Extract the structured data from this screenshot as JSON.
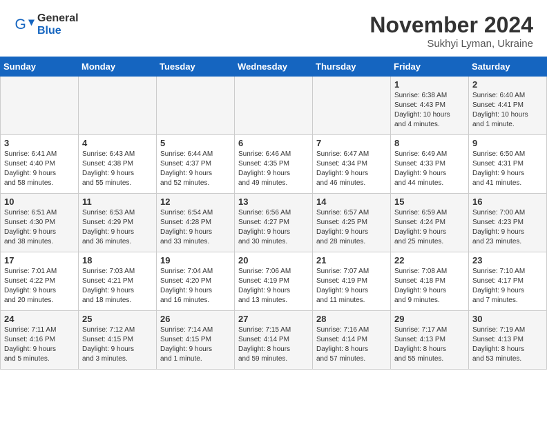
{
  "logo": {
    "general": "General",
    "blue": "Blue"
  },
  "header": {
    "month": "November 2024",
    "location": "Sukhyi Lyman, Ukraine"
  },
  "days_of_week": [
    "Sunday",
    "Monday",
    "Tuesday",
    "Wednesday",
    "Thursday",
    "Friday",
    "Saturday"
  ],
  "weeks": [
    [
      {
        "day": "",
        "info": ""
      },
      {
        "day": "",
        "info": ""
      },
      {
        "day": "",
        "info": ""
      },
      {
        "day": "",
        "info": ""
      },
      {
        "day": "",
        "info": ""
      },
      {
        "day": "1",
        "info": "Sunrise: 6:38 AM\nSunset: 4:43 PM\nDaylight: 10 hours\nand 4 minutes."
      },
      {
        "day": "2",
        "info": "Sunrise: 6:40 AM\nSunset: 4:41 PM\nDaylight: 10 hours\nand 1 minute."
      }
    ],
    [
      {
        "day": "3",
        "info": "Sunrise: 6:41 AM\nSunset: 4:40 PM\nDaylight: 9 hours\nand 58 minutes."
      },
      {
        "day": "4",
        "info": "Sunrise: 6:43 AM\nSunset: 4:38 PM\nDaylight: 9 hours\nand 55 minutes."
      },
      {
        "day": "5",
        "info": "Sunrise: 6:44 AM\nSunset: 4:37 PM\nDaylight: 9 hours\nand 52 minutes."
      },
      {
        "day": "6",
        "info": "Sunrise: 6:46 AM\nSunset: 4:35 PM\nDaylight: 9 hours\nand 49 minutes."
      },
      {
        "day": "7",
        "info": "Sunrise: 6:47 AM\nSunset: 4:34 PM\nDaylight: 9 hours\nand 46 minutes."
      },
      {
        "day": "8",
        "info": "Sunrise: 6:49 AM\nSunset: 4:33 PM\nDaylight: 9 hours\nand 44 minutes."
      },
      {
        "day": "9",
        "info": "Sunrise: 6:50 AM\nSunset: 4:31 PM\nDaylight: 9 hours\nand 41 minutes."
      }
    ],
    [
      {
        "day": "10",
        "info": "Sunrise: 6:51 AM\nSunset: 4:30 PM\nDaylight: 9 hours\nand 38 minutes."
      },
      {
        "day": "11",
        "info": "Sunrise: 6:53 AM\nSunset: 4:29 PM\nDaylight: 9 hours\nand 36 minutes."
      },
      {
        "day": "12",
        "info": "Sunrise: 6:54 AM\nSunset: 4:28 PM\nDaylight: 9 hours\nand 33 minutes."
      },
      {
        "day": "13",
        "info": "Sunrise: 6:56 AM\nSunset: 4:27 PM\nDaylight: 9 hours\nand 30 minutes."
      },
      {
        "day": "14",
        "info": "Sunrise: 6:57 AM\nSunset: 4:25 PM\nDaylight: 9 hours\nand 28 minutes."
      },
      {
        "day": "15",
        "info": "Sunrise: 6:59 AM\nSunset: 4:24 PM\nDaylight: 9 hours\nand 25 minutes."
      },
      {
        "day": "16",
        "info": "Sunrise: 7:00 AM\nSunset: 4:23 PM\nDaylight: 9 hours\nand 23 minutes."
      }
    ],
    [
      {
        "day": "17",
        "info": "Sunrise: 7:01 AM\nSunset: 4:22 PM\nDaylight: 9 hours\nand 20 minutes."
      },
      {
        "day": "18",
        "info": "Sunrise: 7:03 AM\nSunset: 4:21 PM\nDaylight: 9 hours\nand 18 minutes."
      },
      {
        "day": "19",
        "info": "Sunrise: 7:04 AM\nSunset: 4:20 PM\nDaylight: 9 hours\nand 16 minutes."
      },
      {
        "day": "20",
        "info": "Sunrise: 7:06 AM\nSunset: 4:19 PM\nDaylight: 9 hours\nand 13 minutes."
      },
      {
        "day": "21",
        "info": "Sunrise: 7:07 AM\nSunset: 4:19 PM\nDaylight: 9 hours\nand 11 minutes."
      },
      {
        "day": "22",
        "info": "Sunrise: 7:08 AM\nSunset: 4:18 PM\nDaylight: 9 hours\nand 9 minutes."
      },
      {
        "day": "23",
        "info": "Sunrise: 7:10 AM\nSunset: 4:17 PM\nDaylight: 9 hours\nand 7 minutes."
      }
    ],
    [
      {
        "day": "24",
        "info": "Sunrise: 7:11 AM\nSunset: 4:16 PM\nDaylight: 9 hours\nand 5 minutes."
      },
      {
        "day": "25",
        "info": "Sunrise: 7:12 AM\nSunset: 4:15 PM\nDaylight: 9 hours\nand 3 minutes."
      },
      {
        "day": "26",
        "info": "Sunrise: 7:14 AM\nSunset: 4:15 PM\nDaylight: 9 hours\nand 1 minute."
      },
      {
        "day": "27",
        "info": "Sunrise: 7:15 AM\nSunset: 4:14 PM\nDaylight: 8 hours\nand 59 minutes."
      },
      {
        "day": "28",
        "info": "Sunrise: 7:16 AM\nSunset: 4:14 PM\nDaylight: 8 hours\nand 57 minutes."
      },
      {
        "day": "29",
        "info": "Sunrise: 7:17 AM\nSunset: 4:13 PM\nDaylight: 8 hours\nand 55 minutes."
      },
      {
        "day": "30",
        "info": "Sunrise: 7:19 AM\nSunset: 4:13 PM\nDaylight: 8 hours\nand 53 minutes."
      }
    ]
  ]
}
